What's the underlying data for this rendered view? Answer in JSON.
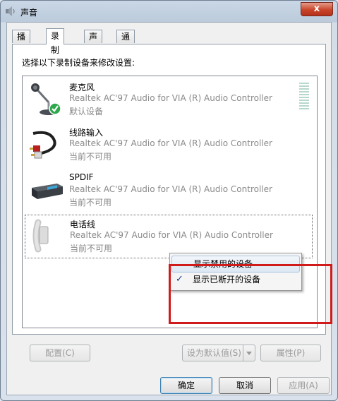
{
  "window": {
    "title": "声音",
    "close_label": "x"
  },
  "tabs": [
    {
      "label": "播放"
    },
    {
      "label": "录制"
    },
    {
      "label": "声音"
    },
    {
      "label": "通信"
    }
  ],
  "panel": {
    "instruction": "选择以下录制设备来修改设置:"
  },
  "devices": [
    {
      "name": "麦克风",
      "driver": "Realtek AC'97 Audio for VIA (R) Audio Controller",
      "status": "默认设备",
      "icon": "microphone-icon"
    },
    {
      "name": "线路输入",
      "driver": "Realtek AC'97 Audio for VIA (R) Audio Controller",
      "status": "当前不可用",
      "icon": "line-in-cable-icon"
    },
    {
      "name": "SPDIF",
      "driver": "Realtek AC'97 Audio for VIA (R) Audio Controller",
      "status": "当前不可用",
      "icon": "spdif-device-icon"
    },
    {
      "name": "电话线",
      "driver": "Realtek AC'97 Audio for VIA (R) Audio Controller",
      "status": "当前不可用",
      "icon": "telephone-handset-icon"
    }
  ],
  "context_menu": {
    "items": [
      {
        "label": "显示禁用的设备",
        "checked": false
      },
      {
        "label": "显示已断开的设备",
        "checked": true
      }
    ],
    "check_glyph": "✓"
  },
  "buttons": {
    "configure": "配置(C)",
    "set_default": "设为默认值(S)",
    "properties": "属性(P)",
    "ok": "确定",
    "cancel": "取消",
    "apply": "应用(A)"
  },
  "colors": {
    "highlight_frame": "#d11a1a",
    "disabled_text": "#8a8a8a"
  }
}
